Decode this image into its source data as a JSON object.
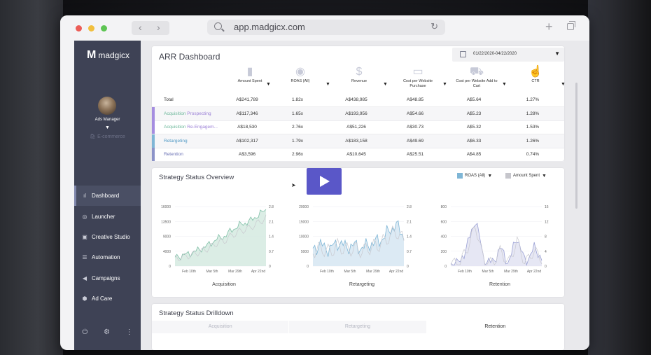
{
  "browser": {
    "url": "app.madgicx.com"
  },
  "sidebar": {
    "brand": "madgicx",
    "user_role": "Ads Manager",
    "user_sub": "E-commerce",
    "items": [
      {
        "label": "Dashboard",
        "icon": "bar-chart-icon",
        "glyph": "▮▮"
      },
      {
        "label": "Launcher",
        "icon": "rocket-icon",
        "glyph": "◎"
      },
      {
        "label": "Creative Studio",
        "icon": "image-icon",
        "glyph": "▣"
      },
      {
        "label": "Automation",
        "icon": "sliders-icon",
        "glyph": "☰"
      },
      {
        "label": "Campaigns",
        "icon": "megaphone-icon",
        "glyph": "◀"
      },
      {
        "label": "Ad Care",
        "icon": "shield-icon",
        "glyph": "⬢"
      }
    ]
  },
  "arr": {
    "title": "ARR Dashboard",
    "date_range": "01/22/2020-04/22/2020",
    "columns": [
      {
        "label": "Amount Spent",
        "icon": "bar-chart-icon",
        "glyph": "▮"
      },
      {
        "label": "ROAS (All)",
        "icon": "globe-icon",
        "glyph": "◉"
      },
      {
        "label": "Revenue",
        "icon": "dollar-icon",
        "glyph": "$"
      },
      {
        "label": "Cost per Website Purchase",
        "icon": "monitor-chart-icon",
        "glyph": "▭"
      },
      {
        "label": "Cost per Website Add to Cart",
        "icon": "cart-icon",
        "glyph": "⛟"
      },
      {
        "label": "CTR",
        "icon": "pointer-icon",
        "glyph": "☝"
      }
    ],
    "rows": [
      {
        "name": "Total",
        "name_parts": [
          "Total",
          ""
        ],
        "bar": "",
        "values": [
          "A$241,789",
          "1.82x",
          "A$438,985",
          "A$48.85",
          "A$5.64",
          "1.27%"
        ]
      },
      {
        "name": "Acquisition Prospecting",
        "name_parts": [
          "Acquisition ",
          "Prospecting"
        ],
        "bar": "#a58de0",
        "values": [
          "A$117,346",
          "1.65x",
          "A$193,956",
          "A$54.66",
          "A$5.23",
          "1.28%"
        ]
      },
      {
        "name": "Acquisition Re-Engagem...",
        "name_parts": [
          "Acquisition ",
          "Re-Engagem..."
        ],
        "bar": "#a58de0",
        "values": [
          "A$18,530",
          "2.76x",
          "A$51,226",
          "A$30.73",
          "A$5.32",
          "1.53%"
        ]
      },
      {
        "name": "Retargeting",
        "name_parts": [
          "Retargeting",
          ""
        ],
        "bar": "#7fb6d6",
        "values": [
          "A$102,317",
          "1.79x",
          "A$183,158",
          "A$49.69",
          "A$6.33",
          "1.26%"
        ]
      },
      {
        "name": "Retention",
        "name_parts": [
          "Retention",
          ""
        ],
        "bar": "#8c93c8",
        "values": [
          "A$3,596",
          "2.96x",
          "A$10,645",
          "A$25.51",
          "A$4.85",
          "0.74%"
        ]
      }
    ]
  },
  "overview": {
    "title": "Strategy Status Overview",
    "legend": [
      {
        "label": "ROAS (All)",
        "color": "#7fb6d6"
      },
      {
        "label": "Amount Spent",
        "color": "#c6c6cc"
      }
    ],
    "charts": [
      {
        "name": "Acquisition",
        "color": "#7fbfa6",
        "fill": "#d7ebe2",
        "left_ticks": [
          "16000",
          "13500",
          "9000",
          "4000",
          "0"
        ],
        "right_ticks": [
          "2.8",
          "2.1",
          "1.4",
          "0.7",
          "0"
        ],
        "x_ticks": [
          "Feb 10th",
          "Mar 5th",
          "Mar 29th",
          "Apr 22nd"
        ]
      },
      {
        "name": "Retargeting",
        "color": "#7fb6d6",
        "fill": "#d8e8f3",
        "left_ticks": [
          "20000",
          "15000",
          "10000",
          "5000",
          "0"
        ],
        "right_ticks": [
          "2.8",
          "2.1",
          "1.4",
          "0.7",
          "0"
        ],
        "x_ticks": [
          "Feb 10th",
          "Mar 5th",
          "Mar 29th",
          "Apr 22nd"
        ]
      },
      {
        "name": "Retention",
        "color": "#9aa0d4",
        "fill": "#e3e4f3",
        "left_ticks": [
          "800",
          "600",
          "400",
          "200",
          "0"
        ],
        "right_ticks": [
          "16",
          "12",
          "8",
          "4",
          "0"
        ],
        "x_ticks": [
          "Feb 10th",
          "Mar 5th",
          "Mar 29th",
          "Apr 22nd"
        ]
      }
    ]
  },
  "drilldown": {
    "title": "Strategy Status Drilldown",
    "tabs": [
      "Acquisition",
      "Retargeting",
      "Retention"
    ]
  }
}
